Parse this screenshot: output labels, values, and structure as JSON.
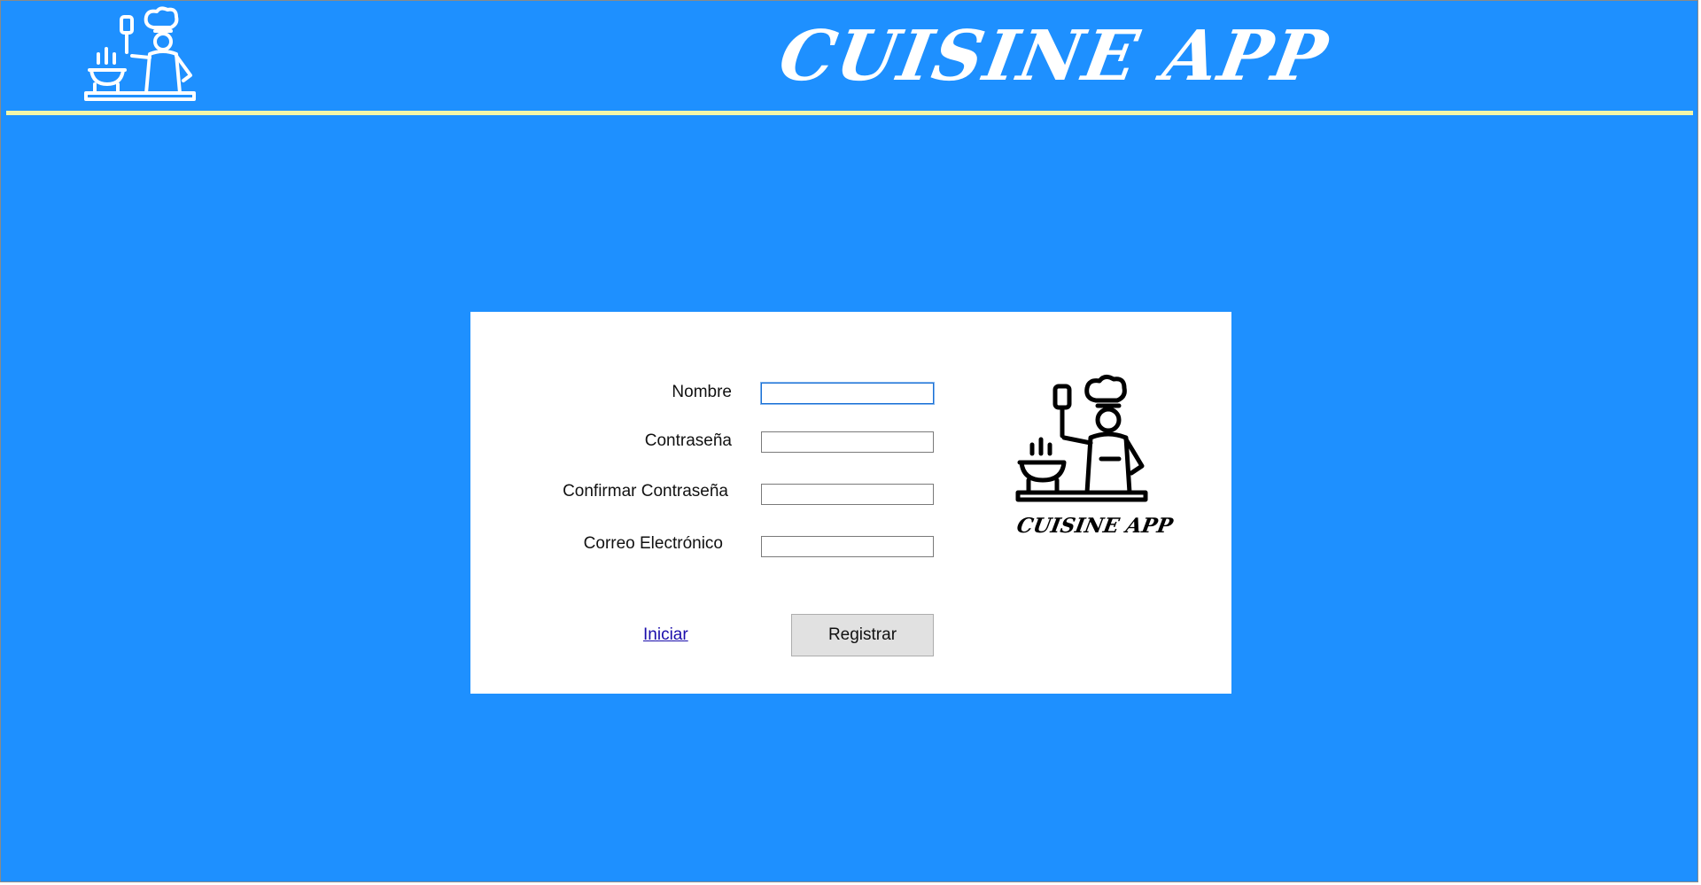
{
  "header": {
    "title": "CUISINE APP",
    "logo_icon": "chef-cooking-icon"
  },
  "form": {
    "fields": [
      {
        "label": "Nombre",
        "value": "",
        "focused": true
      },
      {
        "label": "Contraseña",
        "value": ""
      },
      {
        "label": "Confirmar Contraseña",
        "value": ""
      },
      {
        "label": "Correo Electrónico",
        "value": ""
      }
    ],
    "login_link": "Iniciar",
    "submit_label": "Registrar",
    "logo_text": "CUISINE APP",
    "logo_icon": "chef-cooking-icon"
  },
  "colors": {
    "background": "#1e90ff",
    "divider": "#f3f6a8",
    "card": "#ffffff",
    "button": "#e1e1e1"
  }
}
